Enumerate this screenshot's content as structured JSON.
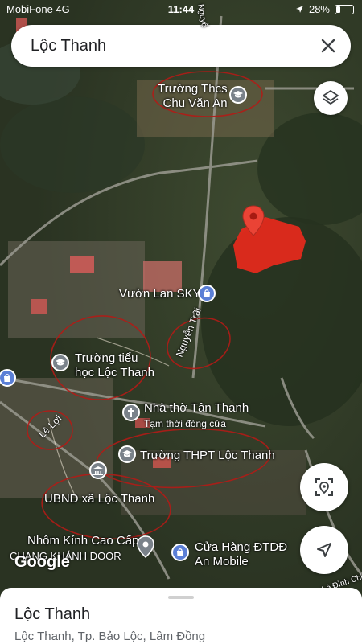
{
  "status_bar": {
    "carrier": "MobiFone 4G",
    "time": "11:44",
    "battery": "28%",
    "battery_level": 0.28
  },
  "search": {
    "query": "Lộc Thanh"
  },
  "map": {
    "road_labels": {
      "nguyen_trai": "Nguyễn Trãi",
      "le_loi": "Lê Lợi",
      "le_dinh_chinh": "Lê Đình Chi",
      "nguyen_top": "Nguyễ"
    },
    "places": {
      "thcs": "Trường Thcs\nChu Văn An",
      "orchid": "Vườn Lan SKY",
      "tieu_hoc": "Trường tiểu\nhọc Lộc Thanh",
      "church": "Nhà thờ Tân Thanh",
      "church_status": "Tạm thời đóng cửa",
      "thpt": "Trường THPT Lộc Thanh",
      "ubnd": "UBND xã Lộc Thanh",
      "glass_line1": "Nhôm Kính Cao Cấp",
      "glass_line2": "CHANG KHÁNH DOOR",
      "phone_store": "Cửa Hàng ĐTDĐ\nAn Mobile"
    },
    "watermark": "Google",
    "colors": {
      "pin": "#ea4335",
      "annotation": "#b31b17",
      "poi_blue": "#5b7fd6",
      "poi_gray": "#7a828a"
    }
  },
  "place_sheet": {
    "title": "Lộc Thanh",
    "subtitle": "Lộc Thanh, Tp. Bảo Lộc, Lâm Đồng"
  }
}
